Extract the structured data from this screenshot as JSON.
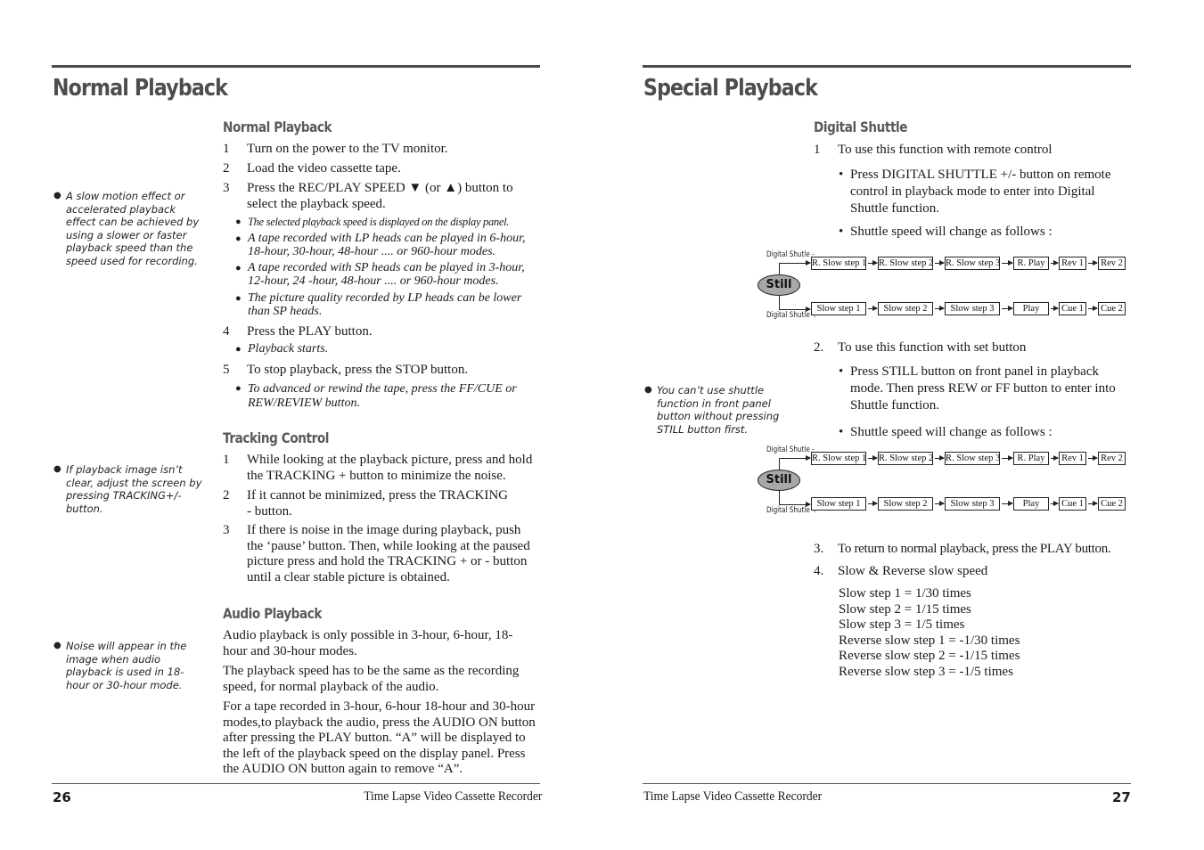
{
  "left_page": {
    "title": "Normal Playback",
    "page_number": "26",
    "footer": "Time Lapse Video Cassette Recorder",
    "sections": {
      "normal": {
        "heading": "Normal Playback",
        "steps": [
          {
            "num": "1",
            "text": "Turn on the power to the TV monitor."
          },
          {
            "num": "2",
            "text": "Load the video cassette tape."
          },
          {
            "num": "3",
            "text": "Press the REC/PLAY SPEED ▼ (or ▲) button to select the playback speed."
          },
          {
            "num": "4",
            "text": "Press the PLAY button."
          },
          {
            "num": "5",
            "text": "To stop playback, press the STOP button."
          }
        ],
        "step3_notes": [
          "The selected playback speed is displayed on the display panel.",
          "A tape recorded with LP heads can be played in 6-hour, 18-hour, 30-hour, 48-hour .... or 960-hour modes.",
          "A tape recorded with SP heads can be played in 3-hour, 12-hour, 24 -hour, 48-hour .... or 960-hour modes.",
          "The picture quality recorded by LP heads can be lower than SP heads."
        ],
        "step4_note": "Playback starts.",
        "step5_note": "To advanced or rewind the tape, press the FF/CUE or REW/REVIEW button.",
        "side_note": "A slow motion effect or accelerated playback effect can be achieved by using a slower or faster playback speed than the speed used for recording."
      },
      "tracking": {
        "heading": "Tracking Control",
        "steps": [
          {
            "num": "1",
            "text": "While looking at the playback picture, press and hold the TRACKING + button to minimize the noise."
          },
          {
            "num": "2",
            "text": "If it cannot be minimized, press the TRACKING - button."
          },
          {
            "num": "3",
            "text": "If there is noise in the image during playback, push the ‘pause’ button. Then, while looking at the paused picture press and hold the TRACKING + or - button until a clear stable picture is obtained."
          }
        ],
        "side_note": "If playback image isn’t clear, adjust the screen by pressing TRACKING+/- button."
      },
      "audio": {
        "heading": "Audio Playback",
        "paragraphs": [
          "Audio playback is only possible in 3-hour, 6-hour, 18-hour and 30-hour modes.",
          "The playback speed has to be the same as the recording speed, for normal playback of the audio.",
          "For a tape recorded in 3-hour, 6-hour 18-hour and 30-hour modes,to playback the audio, press the AUDIO ON button after pressing the PLAY button. “A” will be displayed to the left of the playback speed on the display panel. Press the AUDIO ON button again to remove “A”."
        ],
        "side_note": "Noise will appear in the image when audio playback is  used in 18-hour or 30-hour mode."
      }
    }
  },
  "right_page": {
    "title": "Special Playback",
    "page_number": "27",
    "footer": "Time Lapse Video Cassette Recorder",
    "digital_shuttle": {
      "heading": "Digital Shuttle",
      "step1": {
        "num": "1",
        "text": "To use this function with remote control"
      },
      "step1_bullets": [
        "Press DIGITAL SHUTTLE +/- button on remote control in playback mode to enter into Digital Shuttle function.",
        "Shuttle speed will change as follows :"
      ],
      "step2": {
        "num": "2.",
        "text": "To use this function with set button"
      },
      "step2_bullets": [
        "Press STILL button on front panel in playback mode. Then press REW or FF button to enter into Shuttle function.",
        "Shuttle speed will change as follows :"
      ],
      "step3": {
        "num": "3.",
        "text": "To return to normal playback, press the PLAY button."
      },
      "step4": {
        "num": "4.",
        "text": "Slow & Reverse slow speed"
      },
      "speeds": [
        "Slow step 1 = 1/30 times",
        "Slow step 2 = 1/15 times",
        "Slow step 3 = 1/5 times",
        "Reverse slow step 1 = -1/30 times",
        "Reverse slow step 2 = -1/15 times",
        "Reverse slow step 3 = -1/5 times"
      ],
      "side_note": "You can’t use shuttle function in front panel button without pressing STILL button first."
    },
    "diagram": {
      "center_label": "Still",
      "minus_label": "Digital Shutle -",
      "plus_label": "Digital Shutle +",
      "reverse_sequence": [
        "R. Slow step 1",
        "R. Slow step 2",
        "R. Slow step 3",
        "R. Play",
        "Rev 1",
        "Rev 2"
      ],
      "forward_sequence": [
        "Slow step 1",
        "Slow step 2",
        "Slow step 3",
        "Play",
        "Cue 1",
        "Cue 2"
      ]
    }
  }
}
